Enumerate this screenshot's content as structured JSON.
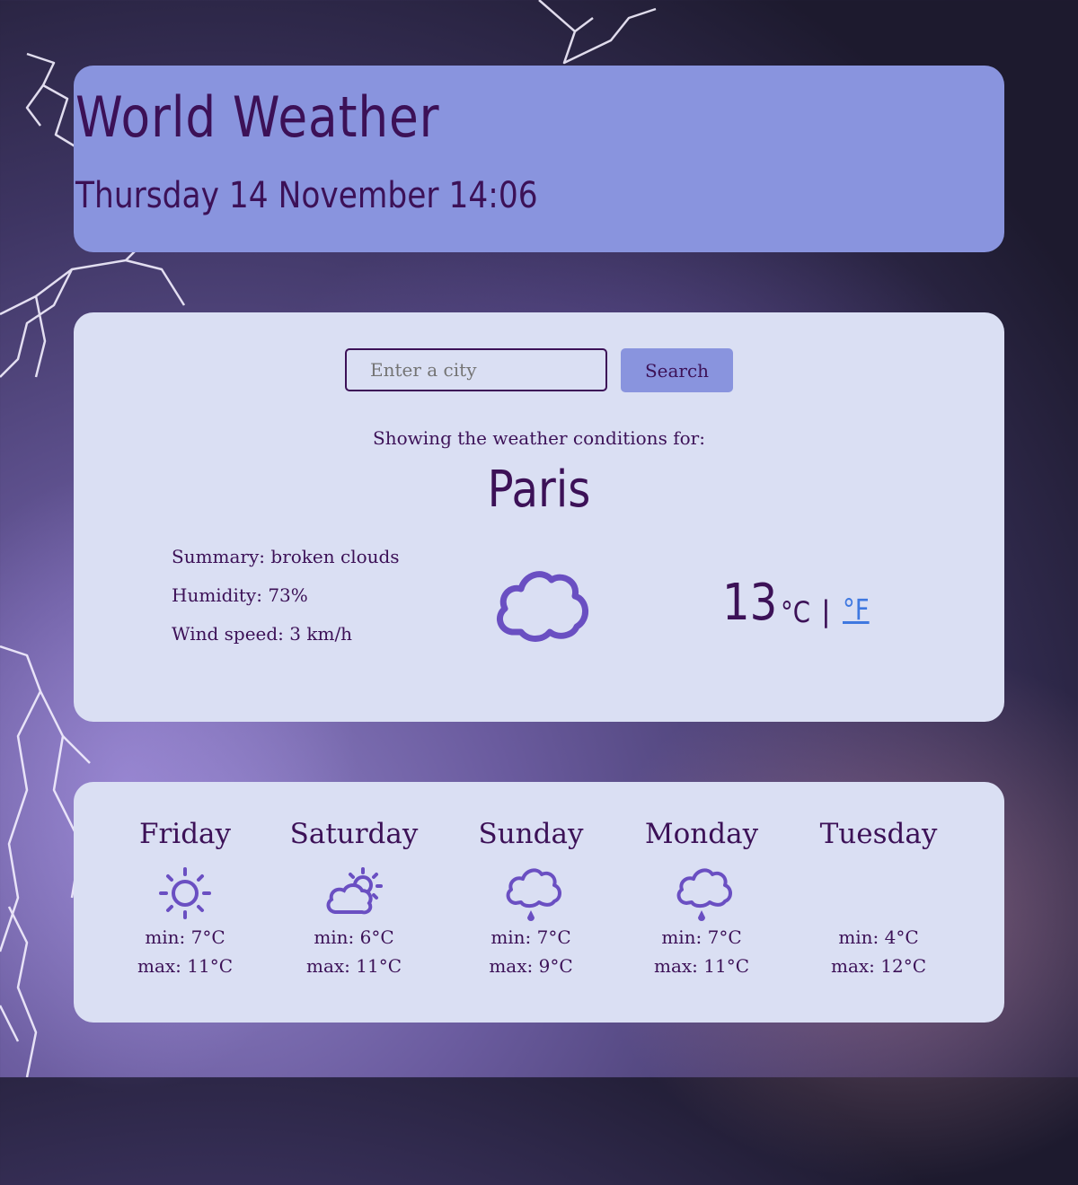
{
  "header": {
    "title": "World Weather",
    "datetime": "Thursday 14 November 14:06"
  },
  "search": {
    "placeholder": "Enter a city",
    "button_label": "Search"
  },
  "current": {
    "showing_label": "Showing the weather conditions for:",
    "city": "Paris",
    "summary": "Summary: broken clouds",
    "humidity": "Humidity: 73%",
    "wind": "Wind speed: 3 km/h",
    "icon": "cloud-icon",
    "temperature": "13",
    "unit_celsius": "°C",
    "unit_separator": "|",
    "unit_fahrenheit": "°F"
  },
  "forecast": [
    {
      "day": "Friday",
      "icon": "sun-icon",
      "min": "min: 7°C",
      "max": "max: 11°C"
    },
    {
      "day": "Saturday",
      "icon": "partly-cloudy-icon",
      "min": "min: 6°C",
      "max": "max: 11°C"
    },
    {
      "day": "Sunday",
      "icon": "rain-icon",
      "min": "min: 7°C",
      "max": "max: 9°C"
    },
    {
      "day": "Monday",
      "icon": "rain-icon",
      "min": "min: 7°C",
      "max": "max: 11°C"
    },
    {
      "day": "Tuesday",
      "icon": "",
      "min": "min: 4°C",
      "max": "max: 12°C"
    }
  ],
  "colors": {
    "header_bg": "#8994de",
    "card_bg": "#dadff3",
    "text": "#3c1157",
    "icon": "#6a4fc2",
    "link": "#3f78e0"
  }
}
